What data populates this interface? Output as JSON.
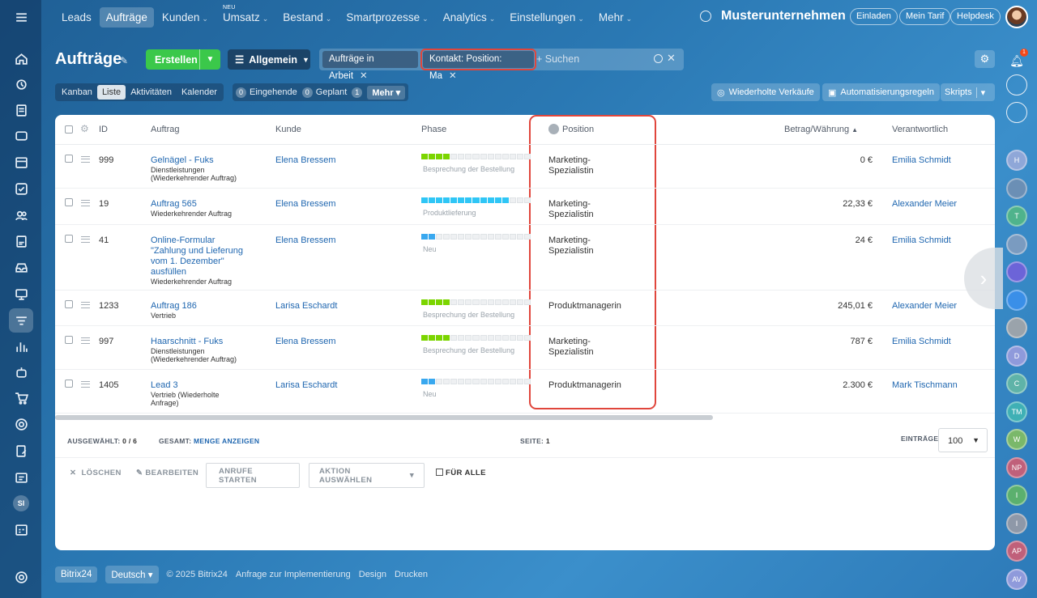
{
  "nav": {
    "items": [
      {
        "label": "Leads",
        "chev": false
      },
      {
        "label": "Aufträge",
        "chev": false,
        "active": true
      },
      {
        "label": "Kunden",
        "chev": true
      },
      {
        "label": "Umsatz",
        "chev": true,
        "badge": "NEU"
      },
      {
        "label": "Bestand",
        "chev": true
      },
      {
        "label": "Smartprozesse",
        "chev": true
      },
      {
        "label": "Analytics",
        "chev": true
      },
      {
        "label": "Einstellungen",
        "chev": true
      },
      {
        "label": "Mehr",
        "chev": true
      }
    ],
    "company": "Musterunternehmen",
    "buttons": [
      "Einladen",
      "Mein Tarif",
      "Helpdesk"
    ]
  },
  "page": {
    "title": "Aufträge",
    "create_label": "Erstellen",
    "filter_preset": "Allgemein",
    "chips": [
      "Aufträge in Arbeit",
      "Kontakt: Position: Ma"
    ],
    "search_placeholder": "+ Suchen"
  },
  "views": {
    "tabs": [
      "Kanban",
      "Liste",
      "Aktivitäten",
      "Kalender"
    ],
    "active": "Liste",
    "counters": [
      {
        "n": "0",
        "label": "Eingehende"
      },
      {
        "n": "0",
        "label": "Geplant"
      },
      {
        "n": "1",
        "label": ""
      }
    ],
    "more": "Mehr"
  },
  "actions": {
    "repeat": "Wiederholte Verkäufe",
    "automation": "Automatisierungsregeln",
    "scripts": "Skripts"
  },
  "table": {
    "headers": {
      "id": "ID",
      "order": "Auftrag",
      "client": "Kunde",
      "phase": "Phase",
      "position": "Position",
      "amount": "Betrag/Währung",
      "owner": "Verantwortlich"
    },
    "rows": [
      {
        "id": "999",
        "title": "Gelnägel - Fuks",
        "sub1": "Dienstleistungen",
        "sub2": "(Wiederkehrender Auftrag)",
        "sub3": "",
        "sub4": "",
        "client": "Elena Bressem",
        "phase": "Besprechung der Bestellung",
        "phase_color": "#7bd500",
        "phase_level": 0.29,
        "pos1": "Marketing-",
        "pos2": "Spezialistin",
        "amount": "0 €",
        "owner": "Emilia Schmidt"
      },
      {
        "id": "19",
        "title": "Auftrag 565",
        "sub1": "Wiederkehrender Auftrag",
        "sub2": "",
        "sub3": "",
        "sub4": "",
        "client": "Elena Bressem",
        "phase": "Produktlieferung",
        "phase_color": "#2fc6f6",
        "phase_level": 0.79,
        "pos1": "Marketing-",
        "pos2": "Spezialistin",
        "amount": "22,33 €",
        "owner": "Alexander Meier"
      },
      {
        "id": "41",
        "title": "Online-Formular",
        "sub1": "\"Zahlung und Lieferung",
        "sub2": "vom 1. Dezember\"",
        "sub3": "ausfüllen",
        "sub4": "Wiederkehrender Auftrag",
        "client": "Elena Bressem",
        "phase": "Neu",
        "phase_color": "#39a8ef",
        "phase_level": 0.1,
        "pos1": "Marketing-",
        "pos2": "Spezialistin",
        "amount": "24 €",
        "owner": "Emilia Schmidt"
      },
      {
        "id": "1233",
        "title": "Auftrag 186",
        "sub1": "Vertrieb",
        "sub2": "",
        "sub3": "",
        "sub4": "",
        "client": "Larisa Eschardt",
        "phase": "Besprechung der Bestellung",
        "phase_color": "#7bd500",
        "phase_level": 0.29,
        "pos1": "Produktmanagerin",
        "pos2": "",
        "amount": "245,01 €",
        "owner": "Alexander Meier"
      },
      {
        "id": "997",
        "title": "Haarschnitt - Fuks",
        "sub1": "Dienstleistungen",
        "sub2": "(Wiederkehrender Auftrag)",
        "sub3": "",
        "sub4": "",
        "client": "Elena Bressem",
        "phase": "Besprechung der Bestellung",
        "phase_color": "#7bd500",
        "phase_level": 0.29,
        "pos1": "Marketing-",
        "pos2": "Spezialistin",
        "amount": "787 €",
        "owner": "Emilia Schmidt"
      },
      {
        "id": "1405",
        "title": "Lead 3",
        "sub1": "Vertrieb (Wiederholte",
        "sub2": "Anfrage)",
        "sub3": "",
        "sub4": "",
        "client": "Larisa Eschardt",
        "phase": "Neu",
        "phase_color": "#39a8ef",
        "phase_level": 0.1,
        "pos1": "Produktmanagerin",
        "pos2": "",
        "amount": "2.300 €",
        "owner": "Mark Tischmann"
      }
    ]
  },
  "footer": {
    "selected_label": "AUSGEWÄHLT:",
    "selected": "0 / 6",
    "total_label": "GESAMT:",
    "total_link": "MENGE ANZEIGEN",
    "page_label": "SEITE:",
    "page": "1",
    "entries_label": "EINTRÄGE",
    "entries": "100",
    "delete": "LÖSCHEN",
    "edit": "BEARBEITEN",
    "calls": "ANRUFE STARTEN",
    "choose": "AKTION AUSWÄHLEN",
    "for_all": "FÜR ALLE"
  },
  "bottom": {
    "brand": "Bitrix24",
    "lang": "Deutsch",
    "copyright": "© 2025 Bitrix24",
    "links": [
      "Anfrage zur Implementierung",
      "Design",
      "Drucken"
    ]
  },
  "rightbar": {
    "notif_count": "1",
    "avatars": [
      {
        "t": "H",
        "c": "#8fa7d8"
      },
      {
        "t": "",
        "c": "#6b8fb5"
      },
      {
        "t": "T",
        "c": "#4fb38c"
      },
      {
        "t": "",
        "c": "#7a9bc0"
      },
      {
        "t": "",
        "c": "#6c64d8"
      },
      {
        "t": "",
        "c": "#3a8fe8"
      },
      {
        "t": "",
        "c": "#9aa3ab"
      },
      {
        "t": "D",
        "c": "#8f9adb"
      },
      {
        "t": "C",
        "c": "#5fb3a8"
      },
      {
        "t": "TM",
        "c": "#3fb0b5"
      },
      {
        "t": "W",
        "c": "#7ab86a"
      },
      {
        "t": "NP",
        "c": "#c0607a"
      },
      {
        "t": "I",
        "c": "#5bb06e"
      },
      {
        "t": "I",
        "c": "#8e98a8"
      },
      {
        "t": "AP",
        "c": "#c0607a"
      },
      {
        "t": "AV",
        "c": "#8f9adb"
      }
    ]
  },
  "leftbar": {
    "si": "SI"
  }
}
